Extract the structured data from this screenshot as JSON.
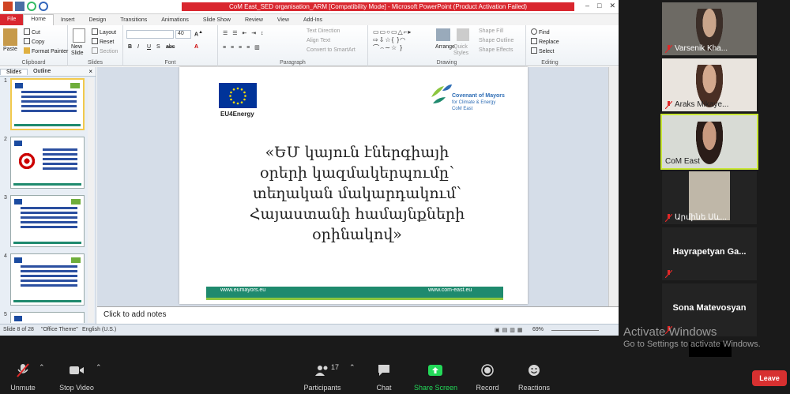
{
  "titlebar": {
    "title": "CoM East_SED organisation_ARM [Compatibility Mode] - Microsoft PowerPoint (Product Activation Failed)"
  },
  "tabs": {
    "file": "File",
    "items": [
      "Home",
      "Insert",
      "Design",
      "Transitions",
      "Animations",
      "Slide Show",
      "Review",
      "View",
      "Add-Ins"
    ]
  },
  "ribbon": {
    "clipboard": {
      "label": "Clipboard",
      "paste": "Paste",
      "cut": "Cut",
      "copy": "Copy",
      "format_painter": "Format Painter"
    },
    "slides": {
      "label": "Slides",
      "new_slide": "New Slide",
      "layout": "Layout",
      "reset": "Reset",
      "section": "Section"
    },
    "font": {
      "label": "Font",
      "size": "40"
    },
    "paragraph": {
      "label": "Paragraph",
      "text_direction": "Text Direction",
      "align_text": "Align Text",
      "convert": "Convert to SmartArt"
    },
    "drawing": {
      "label": "Drawing",
      "arrange": "Arrange",
      "quick_styles": "Quick Styles",
      "shape_fill": "Shape Fill",
      "shape_outline": "Shape Outline",
      "shape_effects": "Shape Effects"
    },
    "editing": {
      "label": "Editing",
      "find": "Find",
      "replace": "Replace",
      "select": "Select"
    }
  },
  "pane": {
    "tab_slides": "Slides",
    "tab_outline": "Outline",
    "close": "×",
    "thumbs": [
      "1",
      "2",
      "3",
      "4",
      "5"
    ]
  },
  "slide": {
    "eu_label": "EU4Energy",
    "com_name": "Covenant of Mayors",
    "com_sub": "for Climate & Energy",
    "com_region": "CoM East",
    "headline": "«ԵՄ կայուն էներգիայի\nօրերի կազմակերպումը՝\nտեղական մակարդակում՝\nՀայաստանի համայնքների\nօրինակով»",
    "url_left": "www.eumayors.eu",
    "url_right": "www.com-east.eu"
  },
  "notes": {
    "placeholder": "Click to add notes"
  },
  "status": {
    "slide": "Slide 8 of 28",
    "theme": "\"Office Theme\"",
    "lang": "English (U.S.)",
    "zoom": "69%"
  },
  "participants": [
    {
      "name": "Varsenik Kha..."
    },
    {
      "name": "Araks Mikaye..."
    },
    {
      "name": "CoM East"
    },
    {
      "name": "Արմինե Սև..."
    },
    {
      "name": "Hayrapetyan  Ga..."
    },
    {
      "name": "Sona Matevosyan"
    }
  ],
  "watermark": {
    "line1": "Activate Windows",
    "line2": "Go to Settings to activate Windows."
  },
  "toolbar": {
    "unmute": "Unmute",
    "stop_video": "Stop Video",
    "participants": "Participants",
    "participants_count": "17",
    "chat": "Chat",
    "share": "Share Screen",
    "record": "Record",
    "reactions": "Reactions",
    "leave": "Leave"
  },
  "colors": {
    "ppt_red": "#d9262e",
    "share_green": "#23d959",
    "leave_red": "#d73030",
    "active_tile": "#c8e633"
  }
}
